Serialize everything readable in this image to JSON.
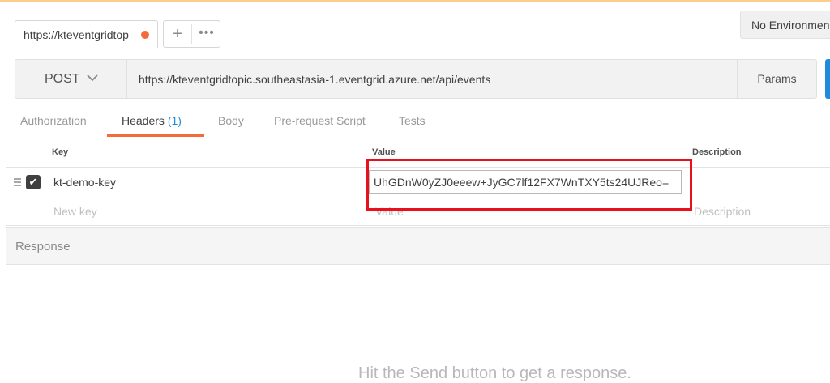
{
  "tab": {
    "label": "https://kteventgridtop",
    "unsaved_color": "#f26b3a"
  },
  "tab_actions": {
    "new_tab_label": "+",
    "more_label": "•••"
  },
  "environment": {
    "selected": "No Environmen"
  },
  "request": {
    "method": "POST",
    "url": "https://kteventgridtopic.southeastasia-1.eventgrid.azure.net/api/events",
    "params_label": "Params"
  },
  "subtabs": {
    "authorization": "Authorization",
    "headers": "Headers",
    "headers_count": "(1)",
    "body": "Body",
    "prerequest": "Pre-request Script",
    "tests": "Tests"
  },
  "headers_table": {
    "columns": {
      "key": "Key",
      "value": "Value",
      "description": "Description"
    },
    "rows": [
      {
        "checked": true,
        "key": "kt-demo-key",
        "value": "UhGDnW0yZJ0eeew+JyGC7lf12FX7WnTXY5ts24UJReo="
      }
    ],
    "new_row": {
      "key_placeholder": "New key",
      "value_placeholder": "Value",
      "description_placeholder": "Description"
    }
  },
  "response": {
    "title": "Response",
    "empty_message": "Hit the Send button to get a response."
  },
  "colors": {
    "accent": "#f26b3a",
    "link": "#1f8bdc",
    "highlight": "#e8101a"
  }
}
